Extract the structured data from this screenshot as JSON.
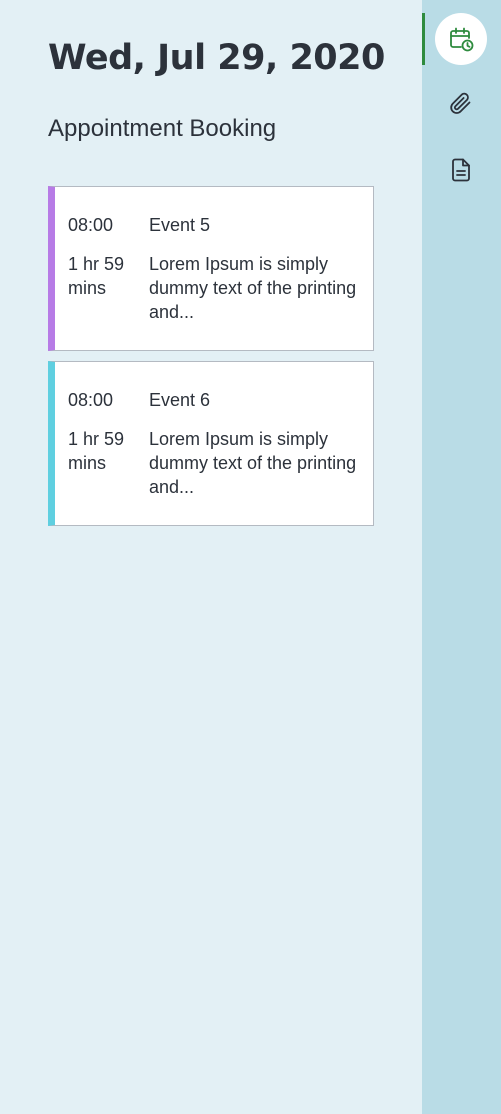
{
  "header": {
    "date": "Wed, Jul 29, 2020",
    "subtitle": "Appointment Booking"
  },
  "events": [
    {
      "time": "08:00",
      "title": "Event 5",
      "duration": "1 hr 59 mins",
      "description": "Lorem Ipsum is simply dummy text of the printing and...",
      "accent": "#b77be6"
    },
    {
      "time": "08:00",
      "title": "Event 6",
      "duration": "1 hr 59 mins",
      "description": "Lorem Ipsum is simply dummy text of the printing and...",
      "accent": "#5fcfe0"
    }
  ],
  "sidebar": {
    "items": [
      {
        "icon": "calendar-clock-icon",
        "active": true,
        "color": "#2e8b3e"
      },
      {
        "icon": "paperclip-icon",
        "active": false,
        "color": "#2c323b"
      },
      {
        "icon": "document-icon",
        "active": false,
        "color": "#2c323b"
      }
    ]
  },
  "colors": {
    "background": "#e3f0f5",
    "rail": "#b9dce6",
    "active_accent": "#2e8b3e"
  }
}
